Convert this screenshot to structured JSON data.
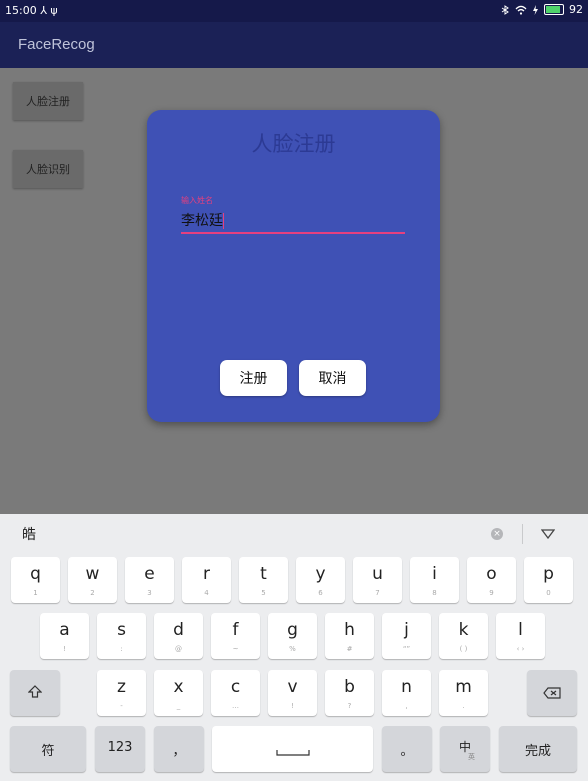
{
  "status_bar": {
    "time": "15:00",
    "left_icons": "⅄ ψ",
    "battery": "92"
  },
  "app_bar": {
    "title": "FaceRecog"
  },
  "side_buttons": {
    "register": "人脸注册",
    "recognize": "人脸识别"
  },
  "dialog": {
    "title": "人脸注册",
    "field_label": "输入姓名",
    "field_value": "李松廷",
    "register_btn": "注册",
    "cancel_btn": "取消"
  },
  "keyboard": {
    "candidate": "皓",
    "row1": [
      {
        "k": "q",
        "s": "1"
      },
      {
        "k": "w",
        "s": "2"
      },
      {
        "k": "e",
        "s": "3"
      },
      {
        "k": "r",
        "s": "4"
      },
      {
        "k": "t",
        "s": "5"
      },
      {
        "k": "y",
        "s": "6"
      },
      {
        "k": "u",
        "s": "7"
      },
      {
        "k": "i",
        "s": "8"
      },
      {
        "k": "o",
        "s": "9"
      },
      {
        "k": "p",
        "s": "0"
      }
    ],
    "row2": [
      {
        "k": "a",
        "s": "!"
      },
      {
        "k": "s",
        "s": ":"
      },
      {
        "k": "d",
        "s": "@"
      },
      {
        "k": "f",
        "s": "~"
      },
      {
        "k": "g",
        "s": "%"
      },
      {
        "k": "h",
        "s": "#"
      },
      {
        "k": "j",
        "s": "“”"
      },
      {
        "k": "k",
        "s": "( )"
      },
      {
        "k": "l",
        "s": "‹ ›"
      }
    ],
    "row3": [
      {
        "k": "z",
        "s": "-"
      },
      {
        "k": "x",
        "s": "_"
      },
      {
        "k": "c",
        "s": "…"
      },
      {
        "k": "v",
        "s": "!"
      },
      {
        "k": "b",
        "s": "?"
      },
      {
        "k": "n",
        "s": ","
      },
      {
        "k": "m",
        "s": "."
      }
    ],
    "symbols": "符",
    "numbers": "123",
    "comma": "，",
    "period": "。",
    "lang": "中",
    "lang_sub": "英",
    "done": "完成"
  }
}
